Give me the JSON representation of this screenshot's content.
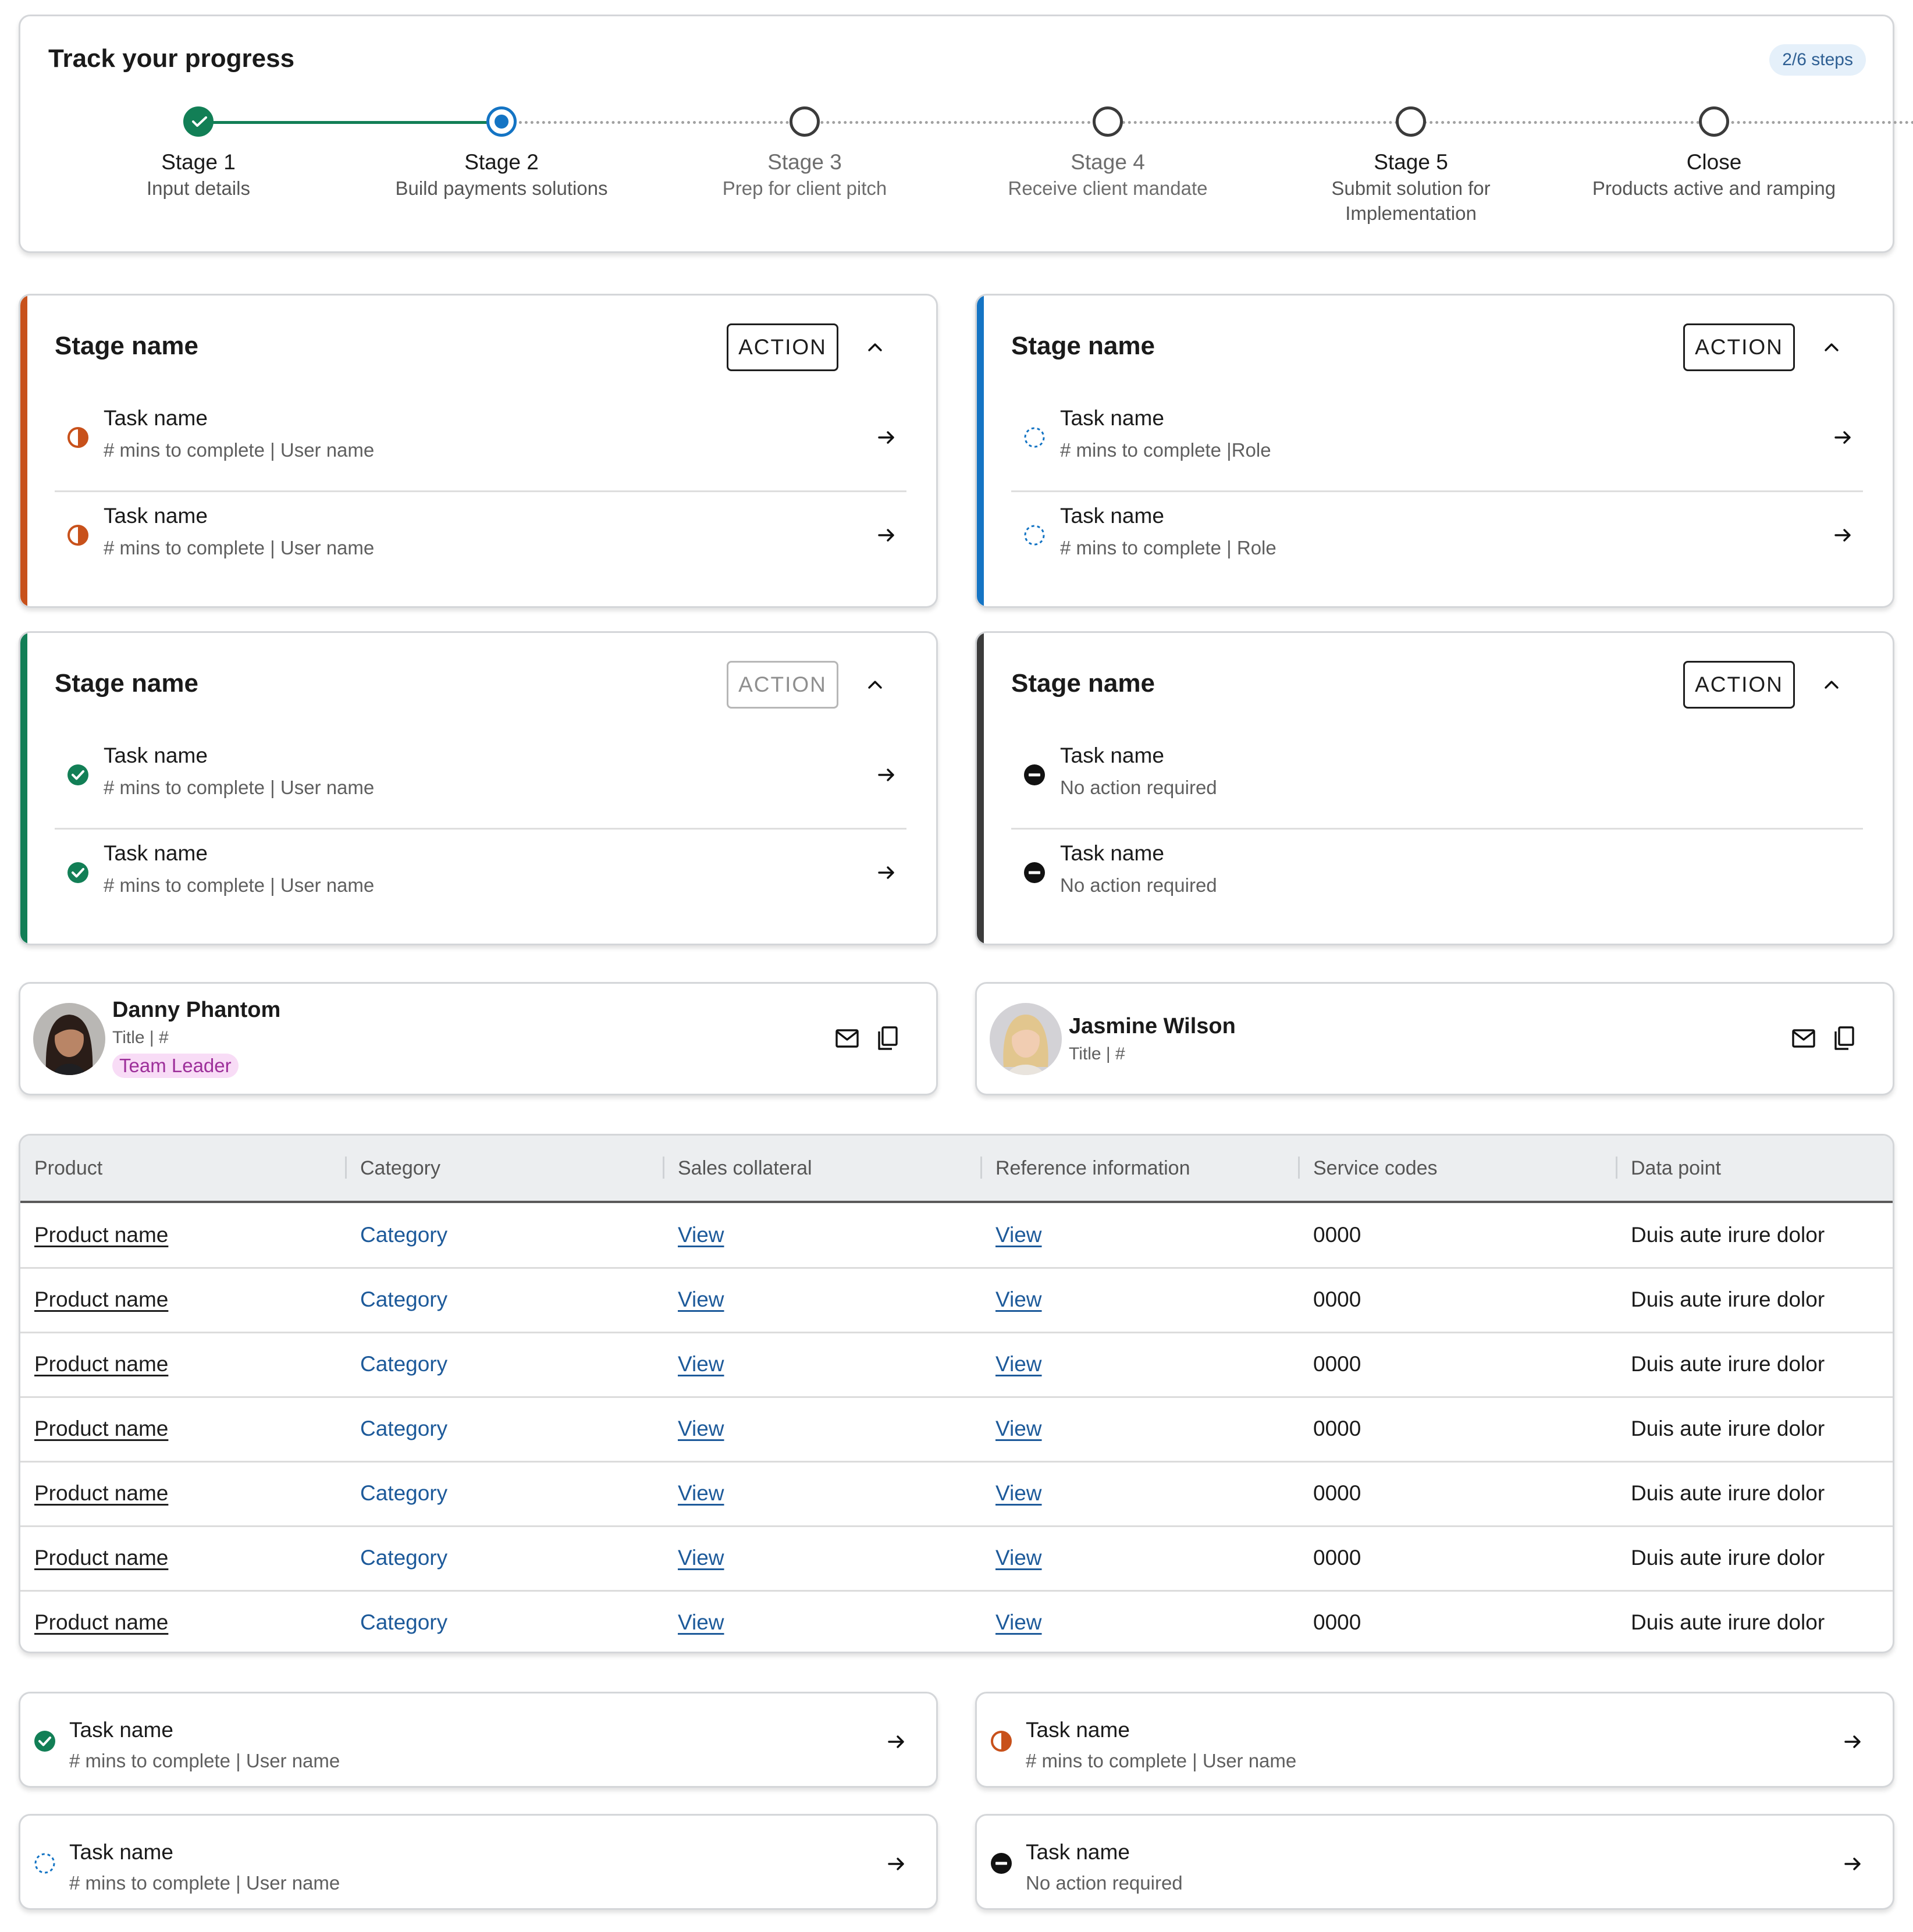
{
  "progress": {
    "title": "Track your progress",
    "steps_badge": "2/6 steps",
    "stages": [
      {
        "name": "Stage 1",
        "desc": "Input details",
        "status": "complete"
      },
      {
        "name": "Stage 2",
        "desc": "Build payments solutions",
        "status": "current"
      },
      {
        "name": "Stage 3",
        "desc": "Prep for client pitch",
        "status": "upcoming"
      },
      {
        "name": "Stage 4",
        "desc": "Receive client mandate",
        "status": "upcoming"
      },
      {
        "name": "Stage 5",
        "desc": "Submit solution for Implementation",
        "status": "upcoming"
      },
      {
        "name": "Close",
        "desc": "Products active and ramping",
        "status": "upcoming"
      }
    ]
  },
  "colors": {
    "in_progress": "#c8511b",
    "active": "#1474c4",
    "complete": "#127f56",
    "no_action": "#3b3b3b",
    "chip_bg": "#f8dcf6",
    "chip_text": "#9d2f9a",
    "link": "#1d5a9a"
  },
  "stage_cards": [
    {
      "title": "Stage name",
      "action": "ACTION",
      "action_enabled": true,
      "status": "in-progress",
      "tasks": [
        {
          "name": "Task name",
          "meta": "# mins to complete | User name",
          "icon": "half-circle-icon"
        },
        {
          "name": "Task name",
          "meta": "# mins to complete | User name",
          "icon": "half-circle-icon"
        }
      ]
    },
    {
      "title": "Stage name",
      "action": "ACTION",
      "action_enabled": true,
      "status": "not-started",
      "tasks": [
        {
          "name": "Task name",
          "meta": "# mins to complete |Role",
          "icon": "dashed-circle-icon"
        },
        {
          "name": "Task name",
          "meta": "# mins to complete | Role",
          "icon": "dashed-circle-icon"
        }
      ]
    },
    {
      "title": "Stage name",
      "action": "ACTION",
      "action_enabled": false,
      "status": "complete",
      "tasks": [
        {
          "name": "Task name",
          "meta": "# mins to complete | User name",
          "icon": "check-circle-icon"
        },
        {
          "name": "Task name",
          "meta": "# mins to complete | User name",
          "icon": "check-circle-icon"
        }
      ]
    },
    {
      "title": "Stage name",
      "action": "ACTION",
      "action_enabled": true,
      "status": "no-action",
      "tasks": [
        {
          "name": "Task name",
          "meta": "No action required",
          "icon": "minus-circle-icon"
        },
        {
          "name": "Task name",
          "meta": "No action required",
          "icon": "minus-circle-icon"
        }
      ]
    }
  ],
  "contacts": [
    {
      "name": "Danny Phantom",
      "title": "Title | #",
      "role": "Team Leader"
    },
    {
      "name": "Jasmine Wilson",
      "title": "Title | #"
    }
  ],
  "table": {
    "columns": [
      "Product",
      "Category",
      "Sales collateral",
      "Reference information",
      "Service codes",
      "Data point"
    ],
    "rows": [
      [
        "Product name",
        "Category",
        "View",
        "View",
        "0000",
        "Duis aute irure dolor"
      ],
      [
        "Product name",
        "Category",
        "View",
        "View",
        "0000",
        "Duis aute irure dolor"
      ],
      [
        "Product name",
        "Category",
        "View",
        "View",
        "0000",
        "Duis aute irure dolor"
      ],
      [
        "Product name",
        "Category",
        "View",
        "View",
        "0000",
        "Duis aute irure dolor"
      ],
      [
        "Product name",
        "Category",
        "View",
        "View",
        "0000",
        "Duis aute irure dolor"
      ],
      [
        "Product name",
        "Category",
        "View",
        "View",
        "0000",
        "Duis aute irure dolor"
      ],
      [
        "Product name",
        "Category",
        "View",
        "View",
        "0000",
        "Duis aute irure dolor"
      ]
    ]
  },
  "task_cards": [
    {
      "name": "Task name",
      "meta": "# mins to complete | User name",
      "icon": "check-circle-icon"
    },
    {
      "name": "Task name",
      "meta": "# mins to complete | User name",
      "icon": "half-circle-icon"
    },
    {
      "name": "Task name",
      "meta": "# mins to complete | User name",
      "icon": "dashed-circle-icon"
    },
    {
      "name": "Task name",
      "meta": "No action required",
      "icon": "minus-circle-icon"
    }
  ]
}
